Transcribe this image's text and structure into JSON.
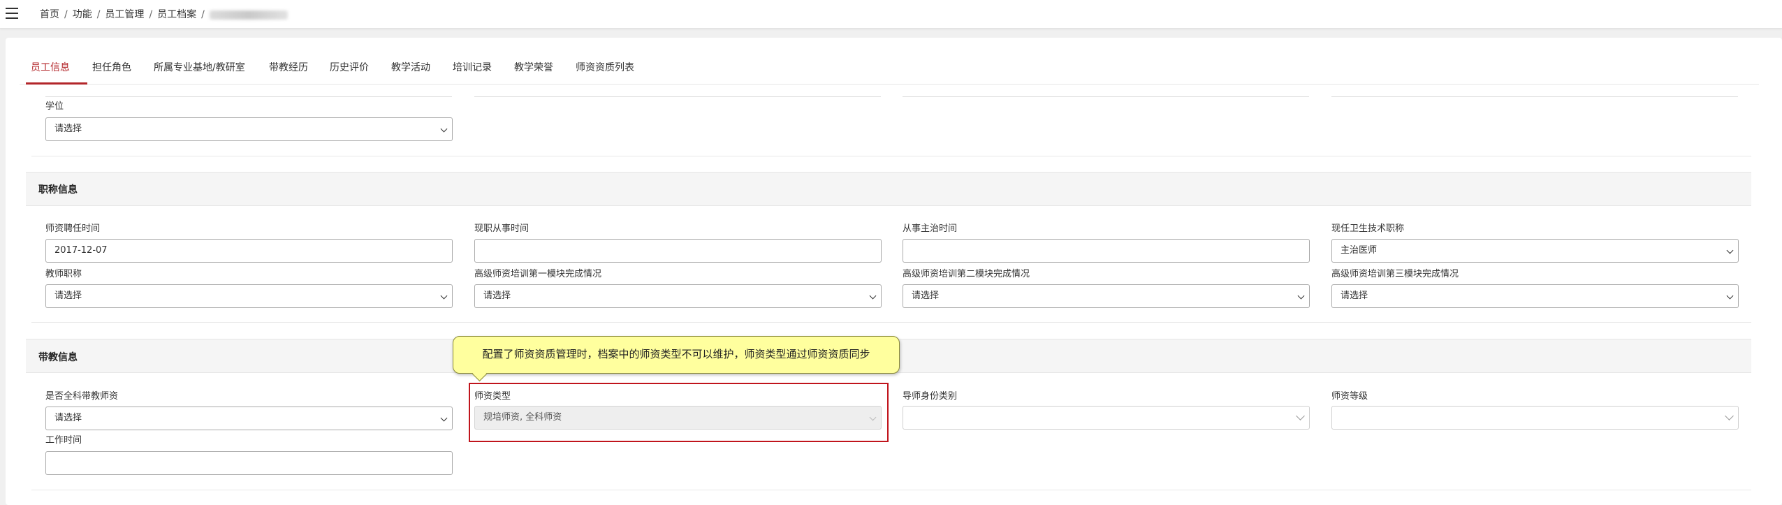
{
  "breadcrumb": {
    "items": [
      "首页",
      "功能",
      "员工管理",
      "员工档案"
    ],
    "separator": "/"
  },
  "tabs": [
    {
      "label": "员工信息",
      "active": true
    },
    {
      "label": "担任角色"
    },
    {
      "label": "所属专业基地/教研室"
    },
    {
      "label": "带教经历"
    },
    {
      "label": "历史评价"
    },
    {
      "label": "教学活动"
    },
    {
      "label": "培训记录"
    },
    {
      "label": "教学荣誉"
    },
    {
      "label": "师资资质列表"
    }
  ],
  "degree": {
    "label": "学位",
    "value": "请选择"
  },
  "title_section": {
    "header": "职称信息",
    "fields": [
      {
        "label": "师资聘任时间",
        "value": "2017-12-07"
      },
      {
        "label": "现职从事时间",
        "value": ""
      },
      {
        "label": "从事主治时间",
        "value": ""
      },
      {
        "label": "现任卫生技术职称",
        "value": "主治医师"
      },
      {
        "label": "教师职称",
        "value": "请选择"
      },
      {
        "label": "高级师资培训第一模块完成情况",
        "value": "请选择"
      },
      {
        "label": "高级师资培训第二模块完成情况",
        "value": "请选择"
      },
      {
        "label": "高级师资培训第三模块完成情况",
        "value": "请选择"
      }
    ]
  },
  "teaching_section": {
    "header": "带教信息",
    "fields": [
      {
        "label": "是否全科带教师资",
        "value": "请选择"
      },
      {
        "label": "师资类型",
        "value": "规培师资, 全科师资"
      },
      {
        "label": "导师身份类别",
        "value": ""
      },
      {
        "label": "师资等级",
        "value": ""
      },
      {
        "label": "工作时间",
        "value": ""
      }
    ]
  },
  "tooltip": {
    "text": "配置了师资资质管理时，档案中的师资类型不可以维护，师资类型通过师资资质同步"
  },
  "colors": {
    "accent": "#b3262a",
    "tooltip_bg": "#ffff9e",
    "highlight": "#c0141c"
  }
}
